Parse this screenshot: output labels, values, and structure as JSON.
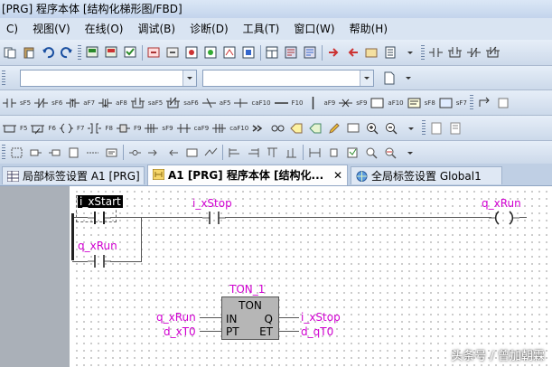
{
  "window": {
    "title": "[PRG] 程序本体 [结构化梯形图/FBD]"
  },
  "menu": [
    "C)",
    "视图(V)",
    "在线(O)",
    "调试(B)",
    "诊断(D)",
    "工具(T)",
    "窗口(W)",
    "帮助(H)"
  ],
  "toolbar_labels": {
    "row3": [
      "sF5",
      "sF6",
      "aF7",
      "aF8",
      "saF5",
      "saF6",
      "aF5",
      "caF10",
      "F10",
      "aF9",
      "sF9",
      "aF10",
      "sF8",
      "sF7"
    ],
    "row4": [
      "F5",
      "F6",
      "F7",
      "F8",
      "F9",
      "sF9",
      "caF9",
      "caF10"
    ]
  },
  "tabs": [
    {
      "label": "局部标签设置 A1 [PRG]"
    },
    {
      "label": "A1 [PRG] 程序本体 [结构化...",
      "close": "✕"
    },
    {
      "label": "全局标签设置 Global1"
    }
  ],
  "ladder": {
    "rung1": {
      "contact1": "i_xStart",
      "contact2": "i_xStop",
      "coil": "q_xRun",
      "parallel_contact": "q_xRun"
    },
    "fb": {
      "instance": "TON_1",
      "type": "TON",
      "in_pins": [
        "IN",
        "PT"
      ],
      "out_pins": [
        "Q",
        "ET"
      ],
      "in_vars": [
        "q_xRun",
        "d_xT0"
      ],
      "out_vars": [
        "i_xStop",
        "d_qT0"
      ]
    }
  },
  "watermark": "头条号 / 曾加朝霖",
  "colors": {
    "variable": "#d000d0",
    "wire": "#555555",
    "canvas": "#ffffff"
  }
}
